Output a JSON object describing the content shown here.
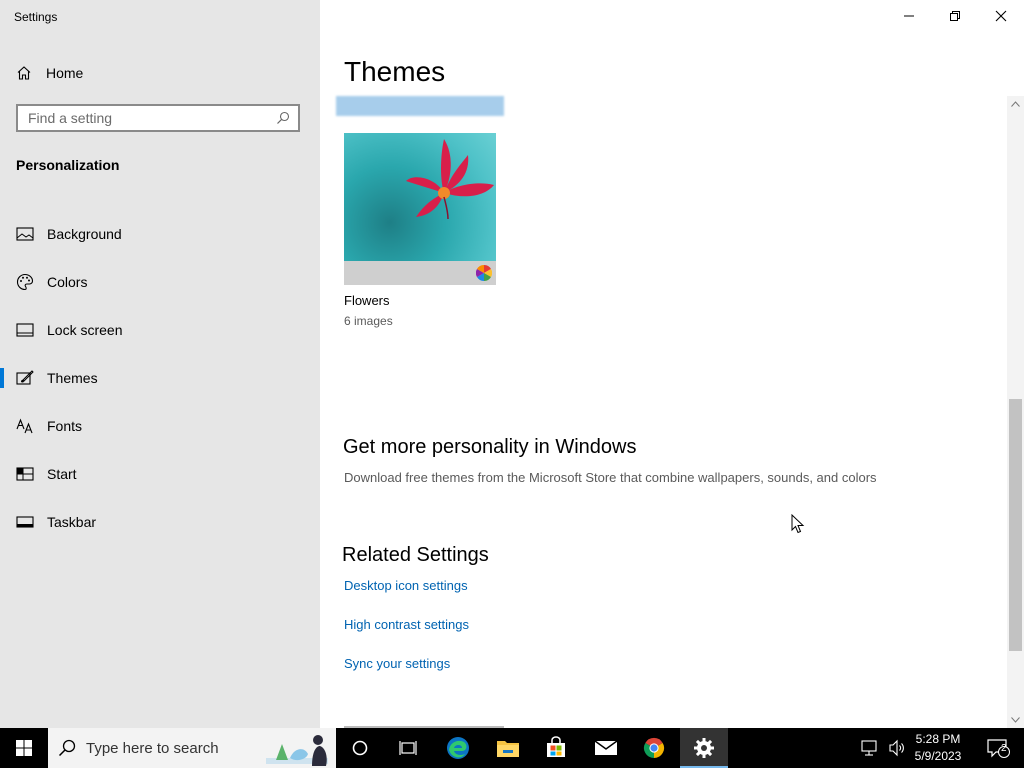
{
  "app": {
    "title": "Settings"
  },
  "sidebar": {
    "home_label": "Home",
    "search_placeholder": "Find a setting",
    "section_title": "Personalization",
    "items": [
      {
        "label": "Background",
        "icon": "picture-icon",
        "active": false
      },
      {
        "label": "Colors",
        "icon": "palette-icon",
        "active": false
      },
      {
        "label": "Lock screen",
        "icon": "lock-screen-icon",
        "active": false
      },
      {
        "label": "Themes",
        "icon": "brush-icon",
        "active": true
      },
      {
        "label": "Fonts",
        "icon": "font-icon",
        "active": false
      },
      {
        "label": "Start",
        "icon": "start-icon",
        "active": false
      },
      {
        "label": "Taskbar",
        "icon": "taskbar-icon",
        "active": false
      }
    ]
  },
  "main": {
    "title": "Themes",
    "theme": {
      "name": "Flowers",
      "subtitle": "6 images"
    },
    "more": {
      "title": "Get more personality in Windows",
      "description": "Download free themes from the Microsoft Store that combine wallpapers, sounds, and colors"
    },
    "related": {
      "title": "Related Settings",
      "links": [
        "Desktop icon settings",
        "High contrast settings",
        "Sync your settings"
      ]
    }
  },
  "taskbar": {
    "search_placeholder": "Type here to search",
    "time": "5:28 PM",
    "date": "5/9/2023",
    "notification_count": "2",
    "apps": [
      "cortana-icon",
      "task-view-icon",
      "edge-icon",
      "file-explorer-icon",
      "store-icon",
      "mail-icon",
      "chrome-icon",
      "settings-icon"
    ]
  },
  "colors": {
    "accent": "#0078d7",
    "link": "#0063b1",
    "sidebar_bg": "#e6e6e6",
    "taskbar_bg": "#000000"
  }
}
